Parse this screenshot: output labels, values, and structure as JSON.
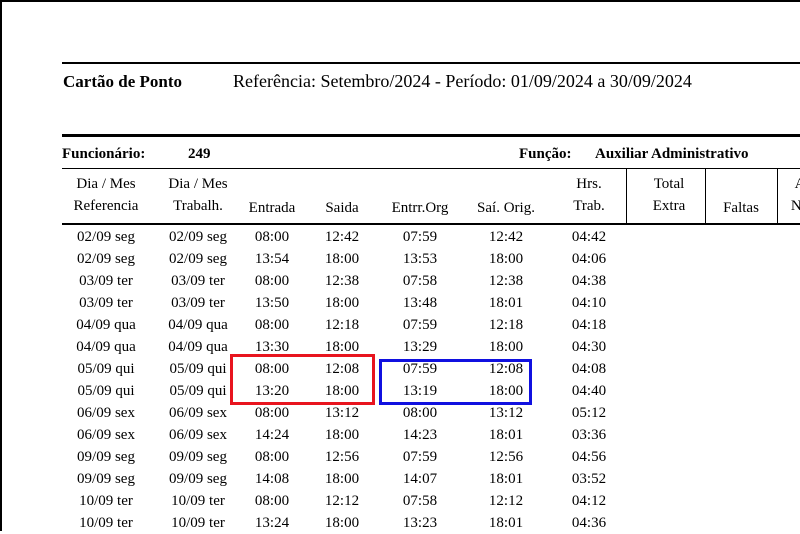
{
  "header": {
    "title": "Cartão de Ponto",
    "reference": "Referência: Setembro/2024 - Período: 01/09/2024 a 30/09/2024"
  },
  "employee": {
    "label": "Funcionário:",
    "number": "249",
    "role_label": "Função:",
    "role_value": "Auxiliar Administrativo"
  },
  "columns": [
    {
      "line1": "Dia / Mes",
      "line2": "Referencia"
    },
    {
      "line1": "Dia / Mes",
      "line2": "Trabalh."
    },
    {
      "line1": "",
      "line2": "Entrada"
    },
    {
      "line1": "",
      "line2": "Saida"
    },
    {
      "line1": "",
      "line2": "Entrr.Org"
    },
    {
      "line1": "",
      "line2": "Saí. Orig."
    },
    {
      "line1": "Hrs.",
      "line2": "Trab."
    },
    {
      "line1": "Total",
      "line2": "Extra"
    },
    {
      "line1": "",
      "line2": "Faltas"
    },
    {
      "line1": "A",
      "line2": "No"
    }
  ],
  "rows": [
    [
      "02/09 seg",
      "02/09 seg",
      "08:00",
      "12:42",
      "07:59",
      "12:42",
      "04:42"
    ],
    [
      "02/09 seg",
      "02/09 seg",
      "13:54",
      "18:00",
      "13:53",
      "18:00",
      "04:06"
    ],
    [
      "03/09 ter",
      "03/09 ter",
      "08:00",
      "12:38",
      "07:58",
      "12:38",
      "04:38"
    ],
    [
      "03/09 ter",
      "03/09 ter",
      "13:50",
      "18:00",
      "13:48",
      "18:01",
      "04:10"
    ],
    [
      "04/09 qua",
      "04/09 qua",
      "08:00",
      "12:18",
      "07:59",
      "12:18",
      "04:18"
    ],
    [
      "04/09 qua",
      "04/09 qua",
      "13:30",
      "18:00",
      "13:29",
      "18:00",
      "04:30"
    ],
    [
      "05/09 qui",
      "05/09 qui",
      "08:00",
      "12:08",
      "07:59",
      "12:08",
      "04:08"
    ],
    [
      "05/09 qui",
      "05/09 qui",
      "13:20",
      "18:00",
      "13:19",
      "18:00",
      "04:40"
    ],
    [
      "06/09 sex",
      "06/09 sex",
      "08:00",
      "13:12",
      "08:00",
      "13:12",
      "05:12"
    ],
    [
      "06/09 sex",
      "06/09 sex",
      "14:24",
      "18:00",
      "14:23",
      "18:01",
      "03:36"
    ],
    [
      "09/09 seg",
      "09/09 seg",
      "08:00",
      "12:56",
      "07:59",
      "12:56",
      "04:56"
    ],
    [
      "09/09 seg",
      "09/09 seg",
      "14:08",
      "18:00",
      "14:07",
      "18:01",
      "03:52"
    ],
    [
      "10/09 ter",
      "10/09 ter",
      "08:00",
      "12:12",
      "07:58",
      "12:12",
      "04:12"
    ],
    [
      "10/09 ter",
      "10/09 ter",
      "13:24",
      "18:00",
      "13:23",
      "18:01",
      "04:36"
    ]
  ],
  "highlights": {
    "red_color": "#e8141e",
    "blue_color": "#1010e0"
  }
}
